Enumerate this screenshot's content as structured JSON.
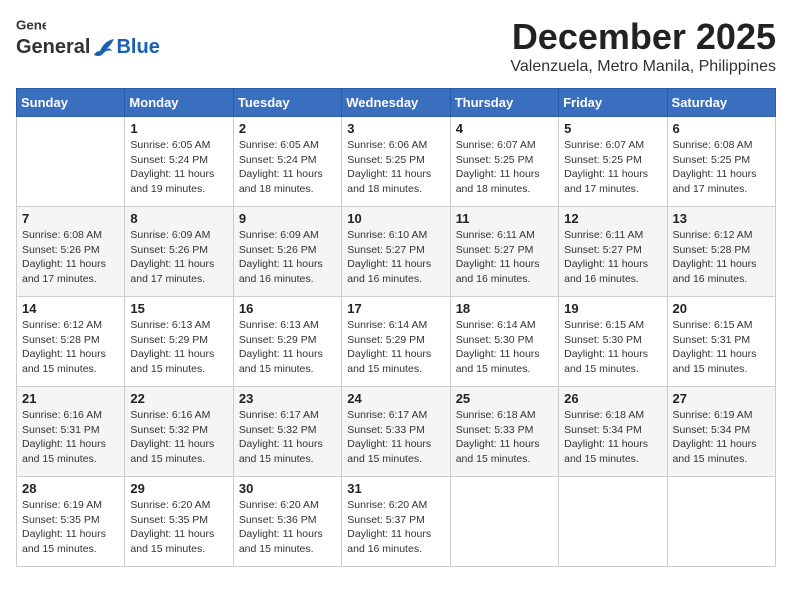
{
  "header": {
    "logo_general": "General",
    "logo_blue": "Blue",
    "month_title": "December 2025",
    "location": "Valenzuela, Metro Manila, Philippines"
  },
  "columns": [
    "Sunday",
    "Monday",
    "Tuesday",
    "Wednesday",
    "Thursday",
    "Friday",
    "Saturday"
  ],
  "weeks": [
    [
      {
        "day": "",
        "sunrise": "",
        "sunset": "",
        "daylight": ""
      },
      {
        "day": "1",
        "sunrise": "6:05 AM",
        "sunset": "5:24 PM",
        "daylight": "11 hours and 19 minutes."
      },
      {
        "day": "2",
        "sunrise": "6:05 AM",
        "sunset": "5:24 PM",
        "daylight": "11 hours and 18 minutes."
      },
      {
        "day": "3",
        "sunrise": "6:06 AM",
        "sunset": "5:25 PM",
        "daylight": "11 hours and 18 minutes."
      },
      {
        "day": "4",
        "sunrise": "6:07 AM",
        "sunset": "5:25 PM",
        "daylight": "11 hours and 18 minutes."
      },
      {
        "day": "5",
        "sunrise": "6:07 AM",
        "sunset": "5:25 PM",
        "daylight": "11 hours and 17 minutes."
      },
      {
        "day": "6",
        "sunrise": "6:08 AM",
        "sunset": "5:25 PM",
        "daylight": "11 hours and 17 minutes."
      }
    ],
    [
      {
        "day": "7",
        "sunrise": "6:08 AM",
        "sunset": "5:26 PM",
        "daylight": "11 hours and 17 minutes."
      },
      {
        "day": "8",
        "sunrise": "6:09 AM",
        "sunset": "5:26 PM",
        "daylight": "11 hours and 17 minutes."
      },
      {
        "day": "9",
        "sunrise": "6:09 AM",
        "sunset": "5:26 PM",
        "daylight": "11 hours and 16 minutes."
      },
      {
        "day": "10",
        "sunrise": "6:10 AM",
        "sunset": "5:27 PM",
        "daylight": "11 hours and 16 minutes."
      },
      {
        "day": "11",
        "sunrise": "6:11 AM",
        "sunset": "5:27 PM",
        "daylight": "11 hours and 16 minutes."
      },
      {
        "day": "12",
        "sunrise": "6:11 AM",
        "sunset": "5:27 PM",
        "daylight": "11 hours and 16 minutes."
      },
      {
        "day": "13",
        "sunrise": "6:12 AM",
        "sunset": "5:28 PM",
        "daylight": "11 hours and 16 minutes."
      }
    ],
    [
      {
        "day": "14",
        "sunrise": "6:12 AM",
        "sunset": "5:28 PM",
        "daylight": "11 hours and 15 minutes."
      },
      {
        "day": "15",
        "sunrise": "6:13 AM",
        "sunset": "5:29 PM",
        "daylight": "11 hours and 15 minutes."
      },
      {
        "day": "16",
        "sunrise": "6:13 AM",
        "sunset": "5:29 PM",
        "daylight": "11 hours and 15 minutes."
      },
      {
        "day": "17",
        "sunrise": "6:14 AM",
        "sunset": "5:29 PM",
        "daylight": "11 hours and 15 minutes."
      },
      {
        "day": "18",
        "sunrise": "6:14 AM",
        "sunset": "5:30 PM",
        "daylight": "11 hours and 15 minutes."
      },
      {
        "day": "19",
        "sunrise": "6:15 AM",
        "sunset": "5:30 PM",
        "daylight": "11 hours and 15 minutes."
      },
      {
        "day": "20",
        "sunrise": "6:15 AM",
        "sunset": "5:31 PM",
        "daylight": "11 hours and 15 minutes."
      }
    ],
    [
      {
        "day": "21",
        "sunrise": "6:16 AM",
        "sunset": "5:31 PM",
        "daylight": "11 hours and 15 minutes."
      },
      {
        "day": "22",
        "sunrise": "6:16 AM",
        "sunset": "5:32 PM",
        "daylight": "11 hours and 15 minutes."
      },
      {
        "day": "23",
        "sunrise": "6:17 AM",
        "sunset": "5:32 PM",
        "daylight": "11 hours and 15 minutes."
      },
      {
        "day": "24",
        "sunrise": "6:17 AM",
        "sunset": "5:33 PM",
        "daylight": "11 hours and 15 minutes."
      },
      {
        "day": "25",
        "sunrise": "6:18 AM",
        "sunset": "5:33 PM",
        "daylight": "11 hours and 15 minutes."
      },
      {
        "day": "26",
        "sunrise": "6:18 AM",
        "sunset": "5:34 PM",
        "daylight": "11 hours and 15 minutes."
      },
      {
        "day": "27",
        "sunrise": "6:19 AM",
        "sunset": "5:34 PM",
        "daylight": "11 hours and 15 minutes."
      }
    ],
    [
      {
        "day": "28",
        "sunrise": "6:19 AM",
        "sunset": "5:35 PM",
        "daylight": "11 hours and 15 minutes."
      },
      {
        "day": "29",
        "sunrise": "6:20 AM",
        "sunset": "5:35 PM",
        "daylight": "11 hours and 15 minutes."
      },
      {
        "day": "30",
        "sunrise": "6:20 AM",
        "sunset": "5:36 PM",
        "daylight": "11 hours and 15 minutes."
      },
      {
        "day": "31",
        "sunrise": "6:20 AM",
        "sunset": "5:37 PM",
        "daylight": "11 hours and 16 minutes."
      },
      {
        "day": "",
        "sunrise": "",
        "sunset": "",
        "daylight": ""
      },
      {
        "day": "",
        "sunrise": "",
        "sunset": "",
        "daylight": ""
      },
      {
        "day": "",
        "sunrise": "",
        "sunset": "",
        "daylight": ""
      }
    ]
  ],
  "labels": {
    "sunrise_prefix": "Sunrise: ",
    "sunset_prefix": "Sunset: ",
    "daylight_prefix": "Daylight: "
  }
}
